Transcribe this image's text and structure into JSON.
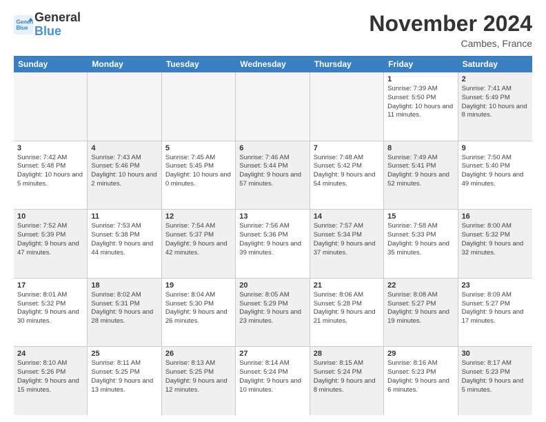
{
  "header": {
    "logo_line1": "General",
    "logo_line2": "Blue",
    "month": "November 2024",
    "location": "Cambes, France"
  },
  "weekdays": [
    "Sunday",
    "Monday",
    "Tuesday",
    "Wednesday",
    "Thursday",
    "Friday",
    "Saturday"
  ],
  "rows": [
    [
      {
        "day": "",
        "info": "",
        "empty": true
      },
      {
        "day": "",
        "info": "",
        "empty": true
      },
      {
        "day": "",
        "info": "",
        "empty": true
      },
      {
        "day": "",
        "info": "",
        "empty": true
      },
      {
        "day": "",
        "info": "",
        "empty": true
      },
      {
        "day": "1",
        "info": "Sunrise: 7:39 AM\nSunset: 5:50 PM\nDaylight: 10 hours and 11 minutes."
      },
      {
        "day": "2",
        "info": "Sunrise: 7:41 AM\nSunset: 5:49 PM\nDaylight: 10 hours and 8 minutes.",
        "alt": true
      }
    ],
    [
      {
        "day": "3",
        "info": "Sunrise: 7:42 AM\nSunset: 5:48 PM\nDaylight: 10 hours and 5 minutes."
      },
      {
        "day": "4",
        "info": "Sunrise: 7:43 AM\nSunset: 5:46 PM\nDaylight: 10 hours and 2 minutes.",
        "alt": true
      },
      {
        "day": "5",
        "info": "Sunrise: 7:45 AM\nSunset: 5:45 PM\nDaylight: 10 hours and 0 minutes."
      },
      {
        "day": "6",
        "info": "Sunrise: 7:46 AM\nSunset: 5:44 PM\nDaylight: 9 hours and 57 minutes.",
        "alt": true
      },
      {
        "day": "7",
        "info": "Sunrise: 7:48 AM\nSunset: 5:42 PM\nDaylight: 9 hours and 54 minutes."
      },
      {
        "day": "8",
        "info": "Sunrise: 7:49 AM\nSunset: 5:41 PM\nDaylight: 9 hours and 52 minutes.",
        "alt": true
      },
      {
        "day": "9",
        "info": "Sunrise: 7:50 AM\nSunset: 5:40 PM\nDaylight: 9 hours and 49 minutes."
      }
    ],
    [
      {
        "day": "10",
        "info": "Sunrise: 7:52 AM\nSunset: 5:39 PM\nDaylight: 9 hours and 47 minutes.",
        "alt": true
      },
      {
        "day": "11",
        "info": "Sunrise: 7:53 AM\nSunset: 5:38 PM\nDaylight: 9 hours and 44 minutes."
      },
      {
        "day": "12",
        "info": "Sunrise: 7:54 AM\nSunset: 5:37 PM\nDaylight: 9 hours and 42 minutes.",
        "alt": true
      },
      {
        "day": "13",
        "info": "Sunrise: 7:56 AM\nSunset: 5:36 PM\nDaylight: 9 hours and 39 minutes."
      },
      {
        "day": "14",
        "info": "Sunrise: 7:57 AM\nSunset: 5:34 PM\nDaylight: 9 hours and 37 minutes.",
        "alt": true
      },
      {
        "day": "15",
        "info": "Sunrise: 7:58 AM\nSunset: 5:33 PM\nDaylight: 9 hours and 35 minutes."
      },
      {
        "day": "16",
        "info": "Sunrise: 8:00 AM\nSunset: 5:32 PM\nDaylight: 9 hours and 32 minutes.",
        "alt": true
      }
    ],
    [
      {
        "day": "17",
        "info": "Sunrise: 8:01 AM\nSunset: 5:32 PM\nDaylight: 9 hours and 30 minutes."
      },
      {
        "day": "18",
        "info": "Sunrise: 8:02 AM\nSunset: 5:31 PM\nDaylight: 9 hours and 28 minutes.",
        "alt": true
      },
      {
        "day": "19",
        "info": "Sunrise: 8:04 AM\nSunset: 5:30 PM\nDaylight: 9 hours and 26 minutes."
      },
      {
        "day": "20",
        "info": "Sunrise: 8:05 AM\nSunset: 5:29 PM\nDaylight: 9 hours and 23 minutes.",
        "alt": true
      },
      {
        "day": "21",
        "info": "Sunrise: 8:06 AM\nSunset: 5:28 PM\nDaylight: 9 hours and 21 minutes."
      },
      {
        "day": "22",
        "info": "Sunrise: 8:08 AM\nSunset: 5:27 PM\nDaylight: 9 hours and 19 minutes.",
        "alt": true
      },
      {
        "day": "23",
        "info": "Sunrise: 8:09 AM\nSunset: 5:27 PM\nDaylight: 9 hours and 17 minutes."
      }
    ],
    [
      {
        "day": "24",
        "info": "Sunrise: 8:10 AM\nSunset: 5:26 PM\nDaylight: 9 hours and 15 minutes.",
        "alt": true
      },
      {
        "day": "25",
        "info": "Sunrise: 8:11 AM\nSunset: 5:25 PM\nDaylight: 9 hours and 13 minutes."
      },
      {
        "day": "26",
        "info": "Sunrise: 8:13 AM\nSunset: 5:25 PM\nDaylight: 9 hours and 12 minutes.",
        "alt": true
      },
      {
        "day": "27",
        "info": "Sunrise: 8:14 AM\nSunset: 5:24 PM\nDaylight: 9 hours and 10 minutes."
      },
      {
        "day": "28",
        "info": "Sunrise: 8:15 AM\nSunset: 5:24 PM\nDaylight: 9 hours and 8 minutes.",
        "alt": true
      },
      {
        "day": "29",
        "info": "Sunrise: 8:16 AM\nSunset: 5:23 PM\nDaylight: 9 hours and 6 minutes."
      },
      {
        "day": "30",
        "info": "Sunrise: 8:17 AM\nSunset: 5:23 PM\nDaylight: 9 hours and 5 minutes.",
        "alt": true
      }
    ]
  ]
}
